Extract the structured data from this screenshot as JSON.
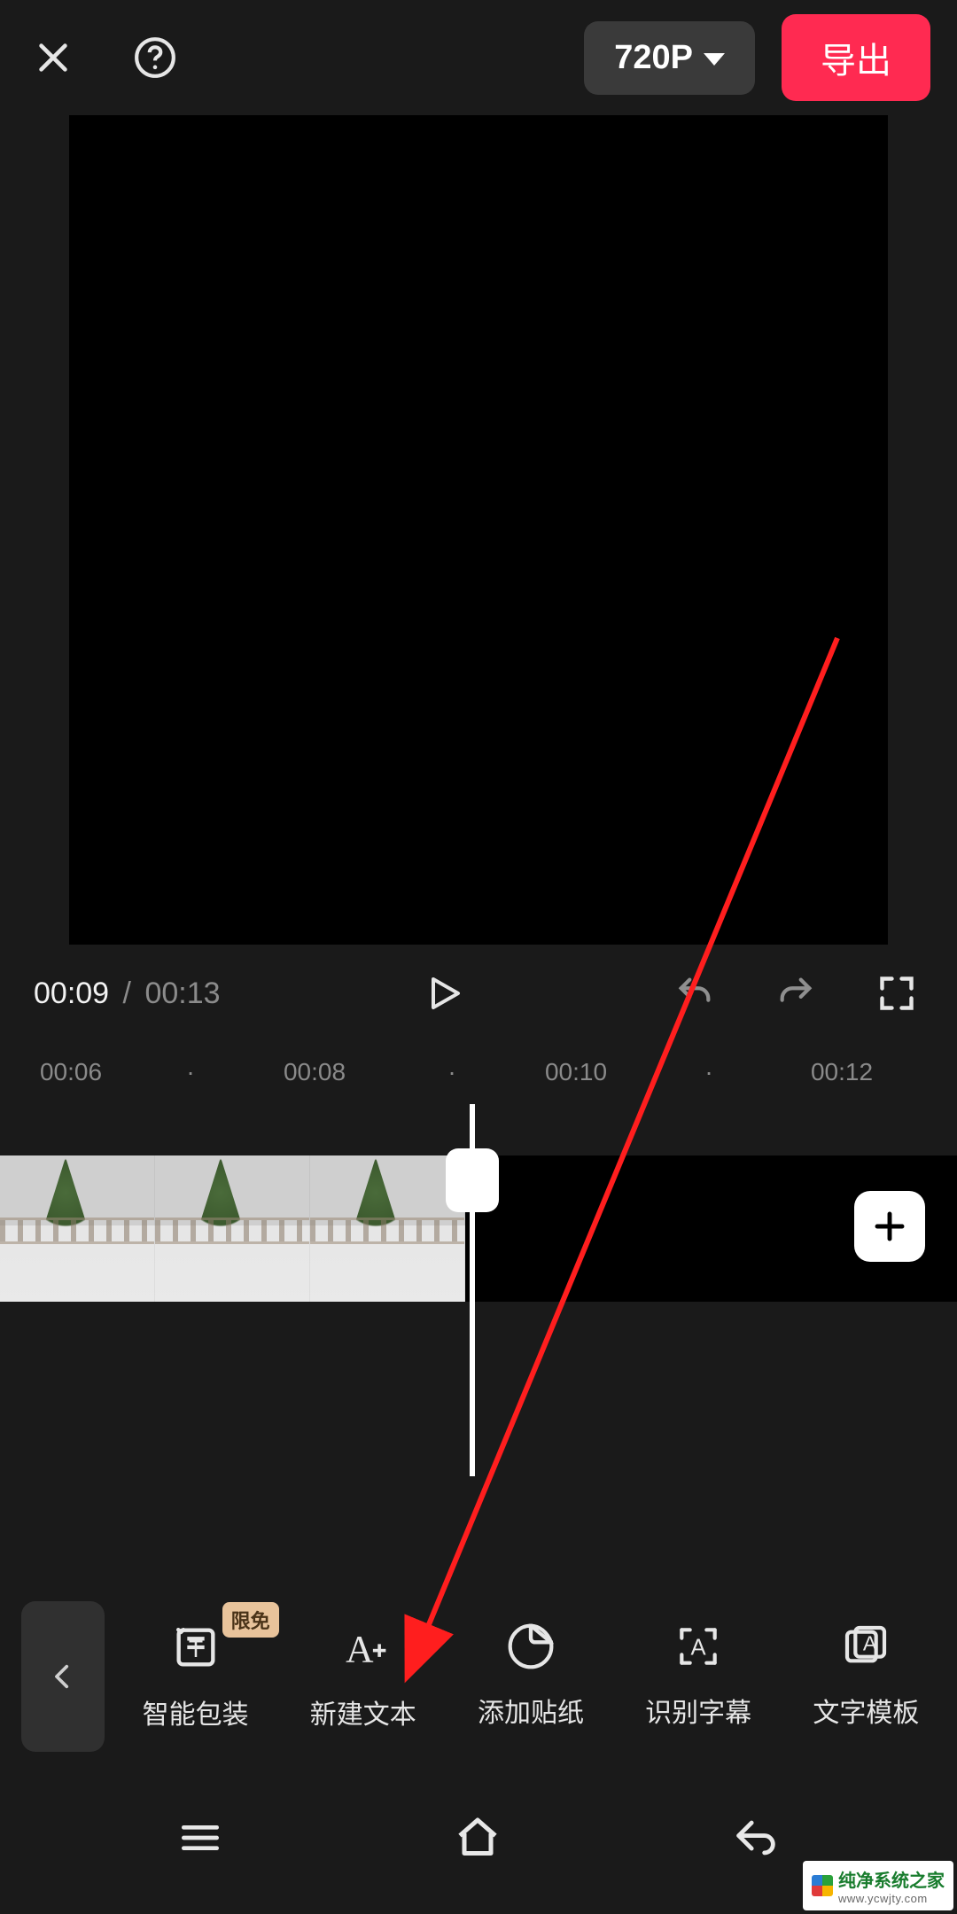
{
  "topbar": {
    "resolution_label": "720P",
    "export_label": "导出"
  },
  "transport": {
    "current_time": "00:09",
    "separator": "/",
    "duration": "00:13"
  },
  "ruler": {
    "ticks": [
      "00:06",
      "00:08",
      "00:10",
      "00:12"
    ]
  },
  "toolbar": {
    "items": [
      {
        "label": "智能包装",
        "badge": "限免"
      },
      {
        "label": "新建文本"
      },
      {
        "label": "添加贴纸"
      },
      {
        "label": "识别字幕"
      },
      {
        "label": "文字模板"
      }
    ]
  },
  "watermark": {
    "title": "纯净系统之家",
    "url": "www.ycwjty.com"
  }
}
